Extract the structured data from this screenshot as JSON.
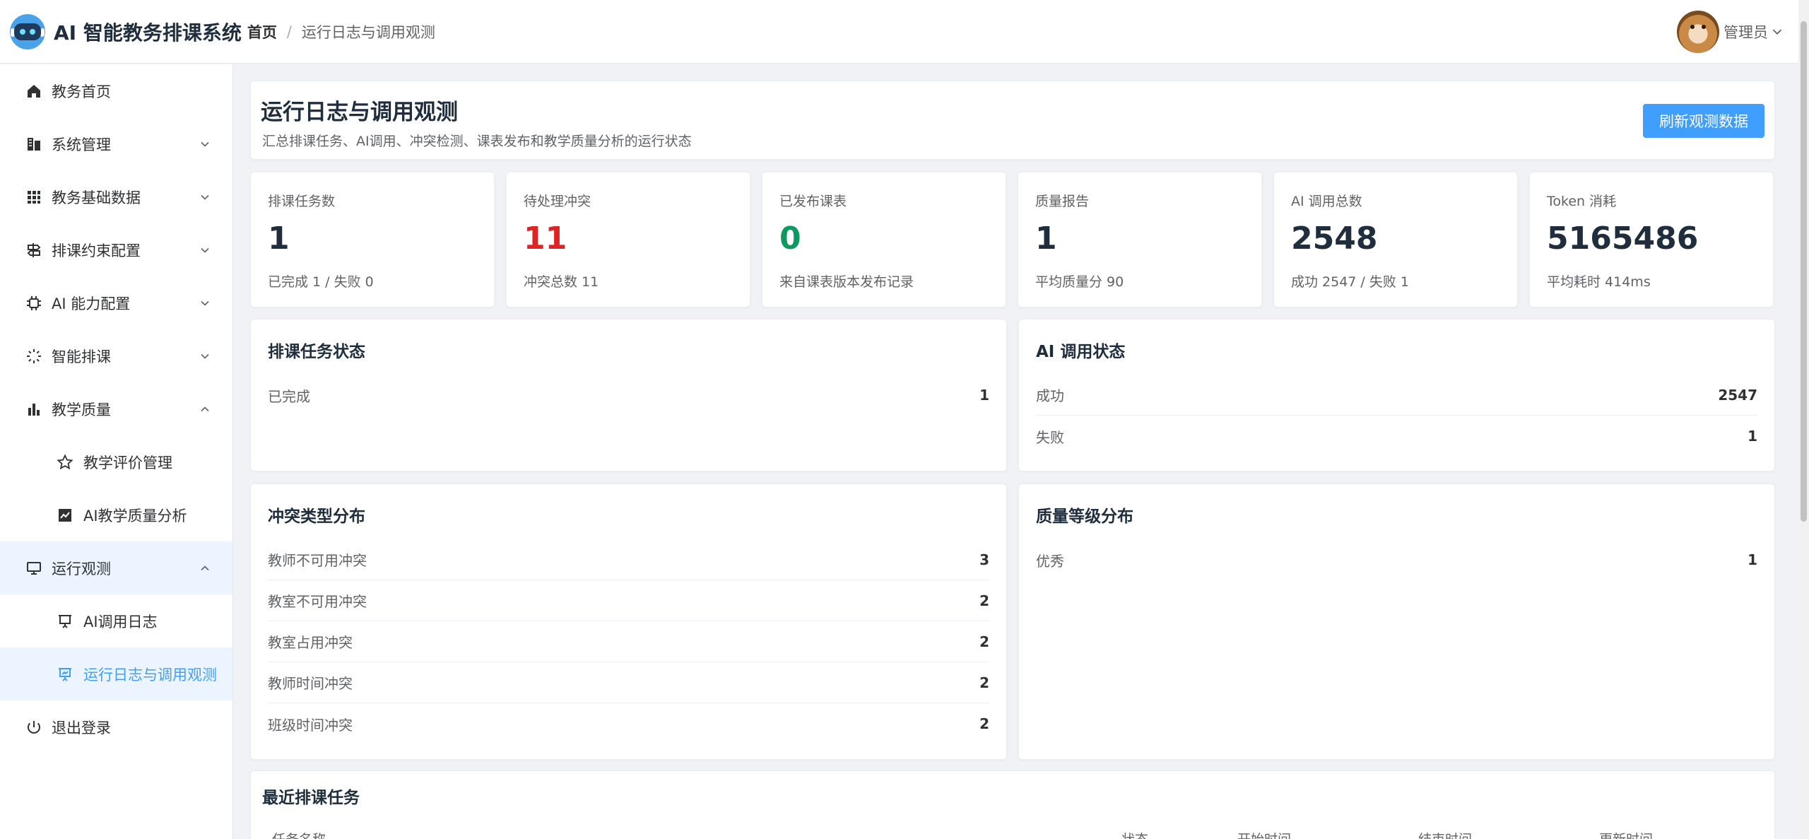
{
  "header": {
    "app_title": "AI 智能教务排课系统",
    "breadcrumb_home": "首页",
    "breadcrumb_sep": "/",
    "breadcrumb_current": "运行日志与调用观测",
    "user_name": "管理员"
  },
  "sidebar": {
    "items": [
      {
        "label": "教务首页",
        "icon": "home-icon"
      },
      {
        "label": "系统管理",
        "icon": "building-icon"
      },
      {
        "label": "教务基础数据",
        "icon": "grid-icon"
      },
      {
        "label": "排课约束配置",
        "icon": "signpost-icon"
      },
      {
        "label": "AI 能力配置",
        "icon": "chip-icon"
      },
      {
        "label": "智能排课",
        "icon": "loading-icon"
      },
      {
        "label": "教学质量",
        "icon": "bar-chart-icon"
      },
      {
        "label": "教学评价管理",
        "icon": "star-icon"
      },
      {
        "label": "AI教学质量分析",
        "icon": "trend-chart-icon"
      },
      {
        "label": "运行观测",
        "icon": "monitor-icon"
      },
      {
        "label": "AI调用日志",
        "icon": "presentation-icon"
      },
      {
        "label": "运行日志与调用观测",
        "icon": "presentation-chart-icon"
      },
      {
        "label": "退出登录",
        "icon": "power-icon"
      }
    ]
  },
  "page": {
    "title": "运行日志与调用观测",
    "subtitle": "汇总排课任务、AI调用、冲突检测、课表发布和教学质量分析的运行状态",
    "refresh_label": "刷新观测数据"
  },
  "stats": [
    {
      "label": "排课任务数",
      "value": "1",
      "sub": "已完成 1 / 失败 0",
      "color": "#1f2d3d"
    },
    {
      "label": "待处理冲突",
      "value": "11",
      "sub": "冲突总数 11",
      "color": "#e02424"
    },
    {
      "label": "已发布课表",
      "value": "0",
      "sub": "来自课表版本发布记录",
      "color": "#0e9960"
    },
    {
      "label": "质量报告",
      "value": "1",
      "sub": "平均质量分 90",
      "color": "#1f2d3d"
    },
    {
      "label": "AI 调用总数",
      "value": "2548",
      "sub": "成功 2547 / 失败 1",
      "color": "#1f2d3d"
    },
    {
      "label": "Token 消耗",
      "value": "5165486",
      "sub": "平均耗时 414ms",
      "color": "#1f2d3d"
    }
  ],
  "task_status": {
    "title": "排课任务状态",
    "rows": [
      {
        "label": "已完成",
        "value": "1"
      }
    ]
  },
  "ai_status": {
    "title": "AI 调用状态",
    "rows": [
      {
        "label": "成功",
        "value": "2547"
      },
      {
        "label": "失败",
        "value": "1"
      }
    ]
  },
  "conflict_dist": {
    "title": "冲突类型分布",
    "rows": [
      {
        "label": "教师不可用冲突",
        "value": "3"
      },
      {
        "label": "教室不可用冲突",
        "value": "2"
      },
      {
        "label": "教室占用冲突",
        "value": "2"
      },
      {
        "label": "教师时间冲突",
        "value": "2"
      },
      {
        "label": "班级时间冲突",
        "value": "2"
      }
    ]
  },
  "quality_dist": {
    "title": "质量等级分布",
    "rows": [
      {
        "label": "优秀",
        "value": "1"
      }
    ]
  },
  "recent_tasks": {
    "title": "最近排课任务",
    "columns": [
      "任务名称",
      "状态",
      "开始时间",
      "结束时间",
      "更新时间"
    ]
  }
}
